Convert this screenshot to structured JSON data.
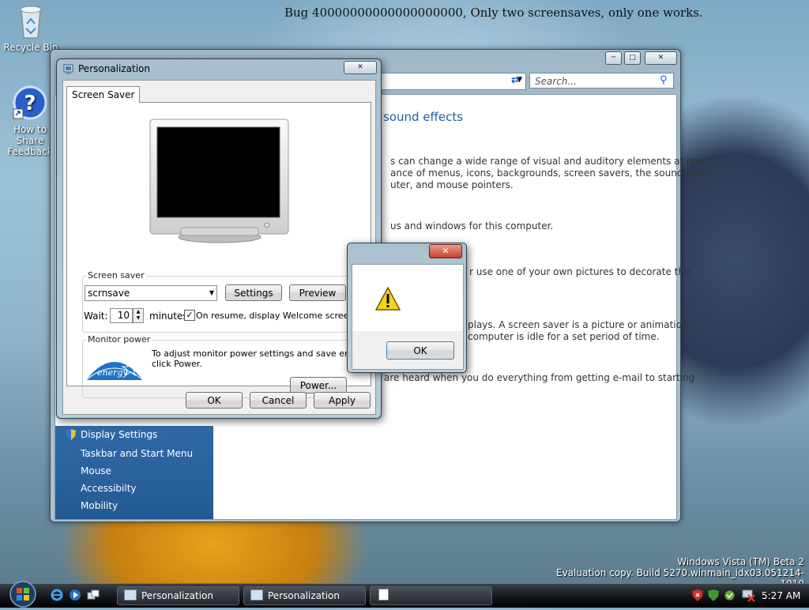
{
  "desktop": {
    "bug_title": "Bug 40000000000000000000, Only two screensaves, only one works.",
    "icons": [
      {
        "label": "Recycle Bin"
      },
      {
        "label": "How to Share Feedback"
      }
    ],
    "watermark": {
      "line1": "Windows Vista (TM) Beta 2",
      "line2": "Evaluation copy. Build 5270.winmain_idx03.051214-1910"
    }
  },
  "back_window": {
    "search_placeholder": "Search...",
    "heading": "sound effects",
    "paragraphs": [
      "s can change a wide range of visual and auditory elements at one",
      "ance of menus, icons, backgrounds, screen savers, the sound when",
      "uter, and mouse pointers.",
      "us and windows for this computer.",
      "r use one of your own pictures to decorate the",
      "plays. A screen saver is a picture or animation",
      "computer is idle for a set period of time.",
      "are heard when you do everything from getting e-mail to starting"
    ],
    "sidebar": [
      "Display Settings",
      "Taskbar and Start Menu",
      "Mouse",
      "Accessibilty",
      "Mobility"
    ]
  },
  "dialog": {
    "title": "Personalization",
    "tab": "Screen Saver",
    "screensaver_group": "Screen saver",
    "screensaver_selected": "scrnsave",
    "settings_btn": "Settings",
    "preview_btn": "Preview",
    "wait_label": "Wait:",
    "wait_value": "10",
    "minutes_label": "minutes",
    "resume_checked": true,
    "resume_label": "On resume, display Welcome screen",
    "monitor_group": "Monitor power",
    "monitor_text_1": "To adjust monitor power settings and save energy,",
    "monitor_text_2": "click Power.",
    "power_btn": "Power...",
    "ok_btn": "OK",
    "cancel_btn": "Cancel",
    "apply_btn": "Apply"
  },
  "alert": {
    "ok_btn": "OK"
  },
  "taskbar": {
    "buttons": [
      "Personalization",
      "Personalization"
    ],
    "time": "5:27 AM"
  },
  "colors": {
    "sidebar_blue": "#2f6aa6",
    "heading_blue": "#1e5fa8"
  }
}
